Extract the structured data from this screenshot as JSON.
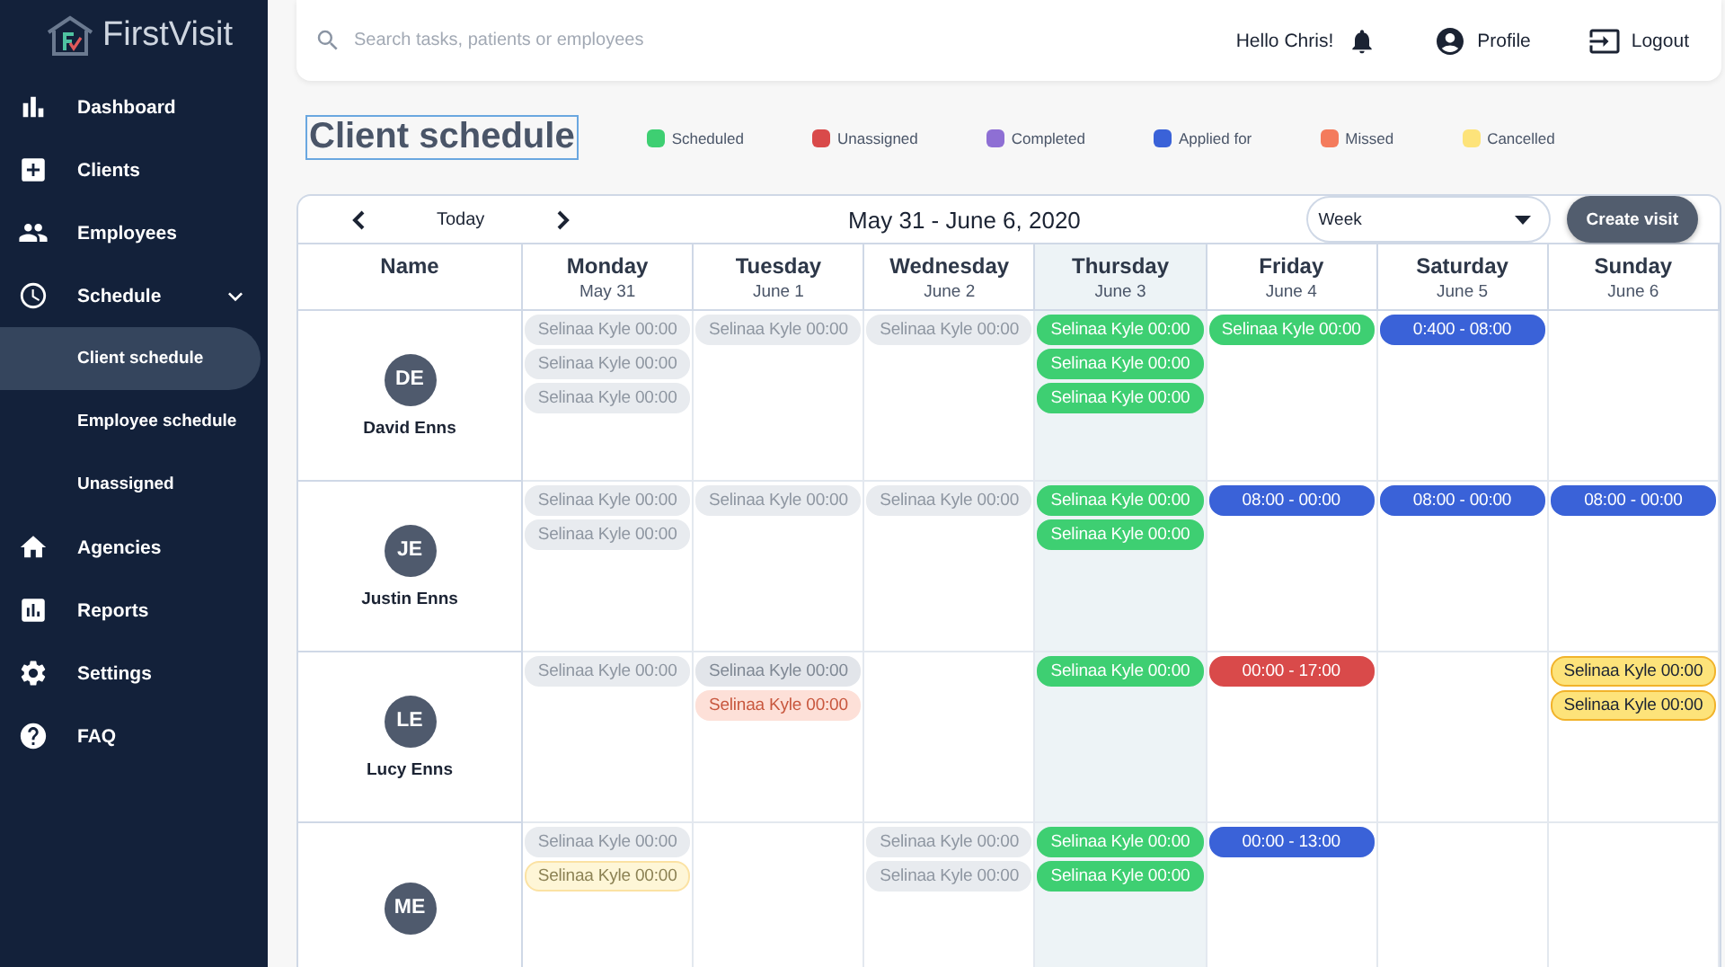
{
  "brand": {
    "name": "FirstVisit"
  },
  "sidebar": {
    "items": [
      {
        "label": "Dashboard",
        "selected": false
      },
      {
        "label": "Clients",
        "selected": false
      },
      {
        "label": "Employees",
        "selected": false
      },
      {
        "label": "Schedule",
        "selected": false,
        "expanded": true,
        "children": [
          {
            "label": "Client schedule",
            "selected": true
          },
          {
            "label": "Employee schedule",
            "selected": false
          },
          {
            "label": "Unassigned",
            "selected": false
          }
        ]
      },
      {
        "label": "Agencies",
        "selected": false
      },
      {
        "label": "Reports",
        "selected": false
      },
      {
        "label": "Settings",
        "selected": false
      },
      {
        "label": "FAQ",
        "selected": false
      }
    ]
  },
  "topbar": {
    "search": {
      "placeholder": "Search tasks, patients or employees"
    },
    "greeting": "Hello Chris!",
    "profile": "Profile",
    "logout": "Logout"
  },
  "page_title": "Client schedule",
  "legend": [
    {
      "label": "Scheduled",
      "color": "#3ecf72"
    },
    {
      "label": "Unassigned",
      "color": "#d94a4a"
    },
    {
      "label": "Completed",
      "color": "#8e6fd4"
    },
    {
      "label": "Applied for",
      "color": "#3a62d8"
    },
    {
      "label": "Missed",
      "color": "#f47b5c"
    },
    {
      "label": "Cancelled",
      "color": "#fde37a"
    }
  ],
  "calendar": {
    "today": "Today",
    "range": "May 31 - June 6, 2020",
    "view": {
      "value": "Week"
    },
    "create_button": "Create visit",
    "name_column": "Name",
    "days": [
      {
        "day": "Monday",
        "date": "May 31",
        "selected": false
      },
      {
        "day": "Tuesday",
        "date": "June 1",
        "selected": false
      },
      {
        "day": "Wednesday",
        "date": "June 2",
        "selected": false
      },
      {
        "day": "Thursday",
        "date": "June 3",
        "selected": true
      },
      {
        "day": "Friday",
        "date": "June 4",
        "selected": false
      },
      {
        "day": "Saturday",
        "date": "June 5",
        "selected": false
      },
      {
        "day": "Sunday",
        "date": "June 6",
        "selected": false
      }
    ],
    "rows": [
      {
        "initials": "DE",
        "name": "David Enns",
        "cells": [
          [
            {
              "text": "Selinaa Kyle 00:00",
              "kind": "past"
            },
            {
              "text": "Selinaa Kyle 00:00",
              "kind": "past"
            },
            {
              "text": "Selinaa Kyle 00:00",
              "kind": "past"
            }
          ],
          [
            {
              "text": "Selinaa Kyle 00:00",
              "kind": "past"
            }
          ],
          [
            {
              "text": "Selinaa Kyle 00:00",
              "kind": "past"
            }
          ],
          [
            {
              "text": "Selinaa Kyle 00:00",
              "kind": "scheduled"
            },
            {
              "text": "Selinaa Kyle 00:00",
              "kind": "scheduled"
            },
            {
              "text": "Selinaa Kyle 00:00",
              "kind": "scheduled"
            }
          ],
          [
            {
              "text": "Selinaa Kyle 00:00",
              "kind": "scheduled"
            }
          ],
          [
            {
              "text": "0:400 - 08:00",
              "kind": "applied"
            }
          ],
          []
        ]
      },
      {
        "initials": "JE",
        "name": "Justin Enns",
        "cells": [
          [
            {
              "text": "Selinaa Kyle 00:00",
              "kind": "past"
            },
            {
              "text": "Selinaa Kyle 00:00",
              "kind": "past"
            }
          ],
          [
            {
              "text": "Selinaa Kyle 00:00",
              "kind": "past"
            }
          ],
          [
            {
              "text": "Selinaa Kyle 00:00",
              "kind": "past"
            }
          ],
          [
            {
              "text": "Selinaa Kyle 00:00",
              "kind": "scheduled"
            },
            {
              "text": "Selinaa Kyle 00:00",
              "kind": "scheduled"
            }
          ],
          [
            {
              "text": "08:00 - 00:00",
              "kind": "applied"
            }
          ],
          [
            {
              "text": "08:00 - 00:00",
              "kind": "applied"
            }
          ],
          [
            {
              "text": "08:00 - 00:00",
              "kind": "applied"
            }
          ]
        ]
      },
      {
        "initials": "LE",
        "name": "Lucy Enns",
        "cells": [
          [
            {
              "text": "Selinaa Kyle 00:00",
              "kind": "past"
            }
          ],
          [
            {
              "text": "Selinaa Kyle 00:00",
              "kind": "pastlight"
            },
            {
              "text": "Selinaa Kyle 00:00",
              "kind": "pastmissed"
            }
          ],
          [],
          [
            {
              "text": "Selinaa Kyle 00:00",
              "kind": "scheduled"
            }
          ],
          [
            {
              "text": "00:00 - 17:00",
              "kind": "unassigned"
            }
          ],
          [],
          [
            {
              "text": "Selinaa Kyle 00:00",
              "kind": "cancelled"
            },
            {
              "text": "Selinaa Kyle 00:00",
              "kind": "cancelled"
            }
          ]
        ]
      },
      {
        "initials": "ME",
        "cells": [
          [
            {
              "text": "Selinaa Kyle 00:00",
              "kind": "past"
            },
            {
              "text": "Selinaa Kyle 00:00",
              "kind": "pastcancelled"
            }
          ],
          [],
          [
            {
              "text": "Selinaa Kyle 00:00",
              "kind": "past"
            },
            {
              "text": "Selinaa Kyle 00:00",
              "kind": "past"
            }
          ],
          [
            {
              "text": "Selinaa Kyle 00:00",
              "kind": "scheduled"
            },
            {
              "text": "Selinaa Kyle 00:00",
              "kind": "scheduled"
            }
          ],
          [
            {
              "text": "00:00 - 13:00",
              "kind": "applied"
            }
          ],
          [],
          []
        ]
      }
    ]
  }
}
